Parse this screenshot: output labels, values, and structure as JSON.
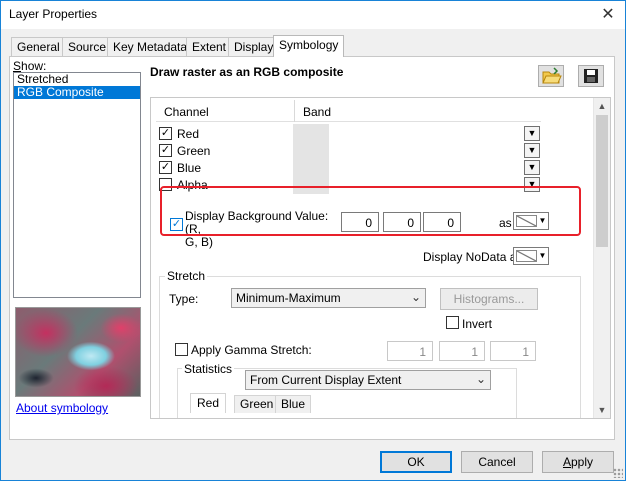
{
  "window": {
    "title": "Layer Properties",
    "close_icon": "close-icon"
  },
  "tabs": [
    {
      "label": "General"
    },
    {
      "label": "Source"
    },
    {
      "label": "Key Metadata"
    },
    {
      "label": "Extent"
    },
    {
      "label": "Display"
    },
    {
      "label": "Symbology",
      "active": true
    }
  ],
  "show": {
    "label": "Show:",
    "items": [
      {
        "label": "Stretched"
      },
      {
        "label": "RGB Composite",
        "selected": true
      }
    ],
    "about_link": "About symbology"
  },
  "panel": {
    "heading": "Draw raster as an RGB composite",
    "open_icon": "open-folder-icon",
    "save_icon": "save-icon"
  },
  "channels": {
    "col_channel": "Channel",
    "col_band": "Band",
    "rows": [
      {
        "label": "Red",
        "checked": true
      },
      {
        "label": "Green",
        "checked": true
      },
      {
        "label": "Blue",
        "checked": true
      },
      {
        "label": "Alpha",
        "checked": false
      }
    ]
  },
  "background": {
    "label_line1": "Display Background Value:(R,",
    "label_line2": "G, B)",
    "checked": true,
    "r": "0",
    "g": "0",
    "b": "0",
    "as_label": "as",
    "nodata_label": "Display NoData as"
  },
  "stretch": {
    "group_label": "Stretch",
    "type_label": "Type:",
    "type_value": "Minimum-Maximum",
    "histograms_button": "Histograms...",
    "invert_label": "Invert",
    "gamma_label": "Apply Gamma Stretch:",
    "gamma_values": [
      "1",
      "1",
      "1"
    ]
  },
  "statistics": {
    "group_label": "Statistics",
    "value": "From Current Display Extent",
    "tabs": [
      "Red",
      "Green",
      "Blue"
    ]
  },
  "buttons": {
    "ok": "OK",
    "cancel": "Cancel",
    "apply": "Apply"
  }
}
